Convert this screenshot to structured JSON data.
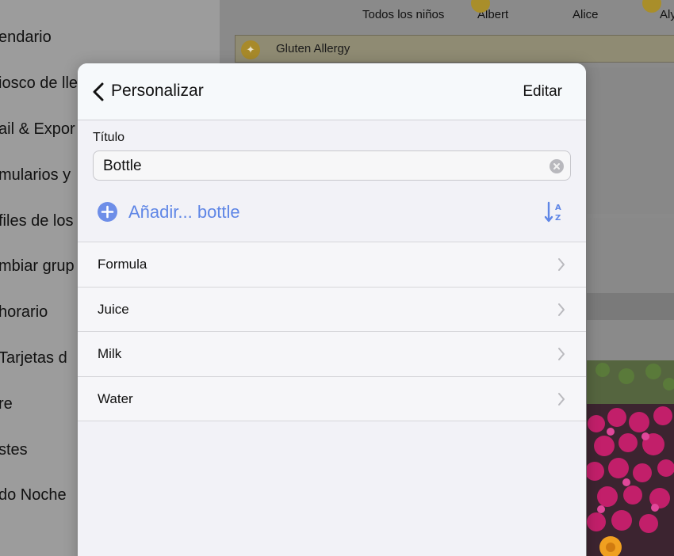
{
  "sidebar": {
    "items": [
      {
        "label": "endario"
      },
      {
        "label": "iosco de lle"
      },
      {
        "label": "ail & Expor"
      },
      {
        "label": "mularios y"
      },
      {
        "label": "files de los"
      },
      {
        "label": "mbiar grup"
      },
      {
        "label": "horario"
      },
      {
        "label": "Tarjetas d"
      },
      {
        "label": "re"
      },
      {
        "label": "stes"
      },
      {
        "label": "do Noche"
      }
    ]
  },
  "header": {
    "kids": [
      {
        "label": "Todos los niños"
      },
      {
        "label": "Albert"
      },
      {
        "label": "Alice"
      },
      {
        "label": "Aly"
      }
    ]
  },
  "allergy": {
    "label": "Gluten Allergy"
  },
  "popover": {
    "nav": {
      "back_icon": "chevron-left-icon",
      "title": "Personalizar",
      "edit_label": "Editar"
    },
    "title_section": {
      "label": "Título",
      "value": "Bottle",
      "clear_icon": "clear-circle-icon"
    },
    "add": {
      "label": "Añadir... bottle",
      "icon": "plus-circle-icon",
      "sort_icon": "sort-az-icon"
    },
    "items": [
      {
        "label": "Formula"
      },
      {
        "label": "Juice"
      },
      {
        "label": "Milk"
      },
      {
        "label": "Water"
      }
    ]
  },
  "colors": {
    "accent": "#5f86e6",
    "allergy_badge": "#a88a2a"
  }
}
